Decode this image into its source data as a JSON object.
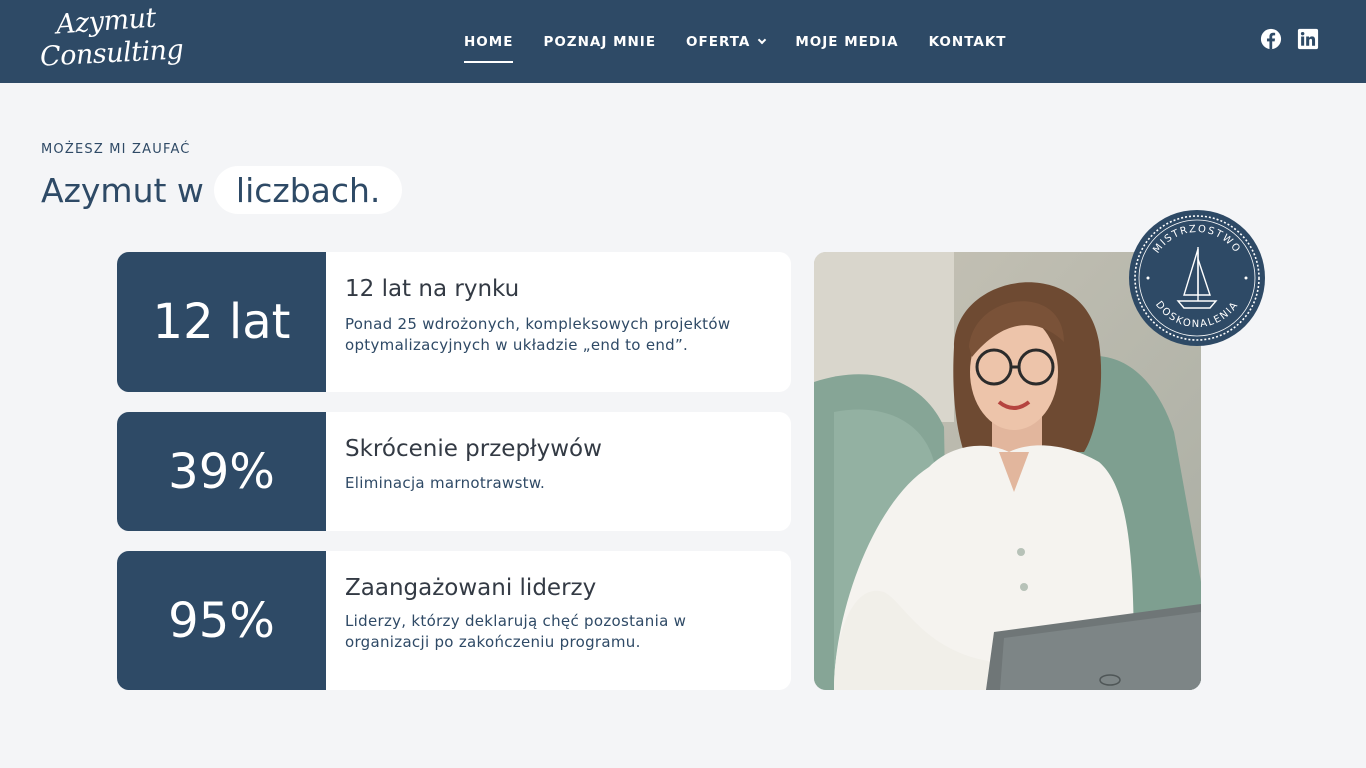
{
  "header": {
    "logo": {
      "line1": "Azymut",
      "line2": "Consulting"
    },
    "nav": [
      {
        "label": "HOME",
        "active": true
      },
      {
        "label": "POZNAJ MNIE",
        "active": false
      },
      {
        "label": "OFERTA",
        "active": false,
        "dropdown": true
      },
      {
        "label": "MOJE MEDIA",
        "active": false
      },
      {
        "label": "KONTAKT",
        "active": false
      }
    ],
    "social": [
      "facebook-icon",
      "linkedin-icon"
    ]
  },
  "section": {
    "eyebrow": "MOŻESZ MI ZAUFAĆ",
    "title": "Azymut w",
    "title_highlight": "liczbach."
  },
  "stats": [
    {
      "value": "12 lat",
      "heading": "12 lat na rynku",
      "description": "Ponad 25 wdrożonych, kompleksowych projektów optymalizacyjnych w układzie „end to end”."
    },
    {
      "value": "39%",
      "heading": "Skrócenie przepływów",
      "description": "Eliminacja marnotrawstw."
    },
    {
      "value": "95%",
      "heading": "Zaangażowani liderzy",
      "description": "Liderzy, którzy deklarują chęć pozostania w organizacji po zakończeniu programu."
    }
  ],
  "badge": {
    "top_text": "MISTRZOSTWO",
    "bottom_text": "DOSKONALENIA"
  },
  "colors": {
    "navy": "#2e4a66",
    "background": "#f4f5f7",
    "card": "#ffffff",
    "heading_text": "#333a44"
  }
}
